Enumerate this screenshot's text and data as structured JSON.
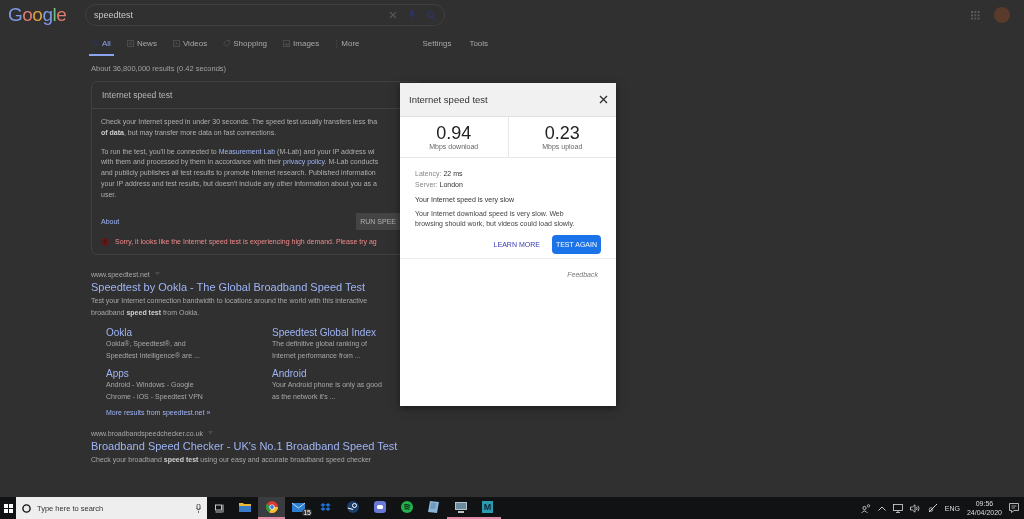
{
  "logo": "Google",
  "search": {
    "value": "speedtest"
  },
  "tabs": [
    {
      "label": "All",
      "kind": "search",
      "selected": true
    },
    {
      "label": "News",
      "kind": "news",
      "selected": false
    },
    {
      "label": "Videos",
      "kind": "play",
      "selected": false
    },
    {
      "label": "Shopping",
      "kind": "tag",
      "selected": false
    },
    {
      "label": "Images",
      "kind": "image",
      "selected": false
    },
    {
      "label": "More",
      "kind": "dots",
      "selected": false
    }
  ],
  "tools": [
    "Settings",
    "Tools"
  ],
  "result_stats": "About 36,800,000 results (0.42 seconds)",
  "speed_card": {
    "title": "Internet speed test",
    "paragraphs": [
      [
        [
          {
            "kind": "text",
            "text": "Check your Internet speed in under 30 seconds. The speed test usually transfers less tha"
          }
        ],
        [
          {
            "kind": "text",
            "text": "**of data**, but may transfer more data on fast connections."
          }
        ]
      ],
      [
        [
          {
            "kind": "text",
            "text": "To run the test, you'll be connected to "
          },
          {
            "kind": "link",
            "text": "Measurement Lab"
          },
          {
            "kind": "text",
            "text": " (M-Lab) and your IP address wi"
          }
        ],
        [
          {
            "kind": "text",
            "text": "with them and processed by them in accordance with their "
          },
          {
            "kind": "link",
            "text": "privacy policy"
          },
          {
            "kind": "text",
            "text": ". M-Lab conducts"
          }
        ],
        [
          {
            "kind": "text",
            "text": "and publicly publishes all test results to promote Internet research. Published information"
          }
        ],
        [
          {
            "kind": "text",
            "text": "your IP address and test results, but doesn't include any other information about you as a"
          }
        ],
        [
          {
            "kind": "text",
            "text": "user."
          }
        ]
      ]
    ],
    "about": "About",
    "run_button": "RUN SPEE",
    "error": "Sorry, it looks like the Internet speed test is experiencing high demand. Please try ag"
  },
  "results": [
    {
      "url": "www.speedtest.net",
      "title": "Speedtest by Ookla - The Global Broadband Speed Test",
      "snippet_lines": [
        "Test your Internet connection bandwidth to locations around the world with this interactive",
        "broadband **speed test** from Ookla."
      ],
      "sitelinks": [
        {
          "title": "Ookla",
          "lines": [
            "Ookla®, Speedtest®, and",
            "Speedtest Intelligence® are ..."
          ]
        },
        {
          "title": "Speedtest Global Index",
          "lines": [
            "The definitive global ranking of",
            "Internet performance from ..."
          ]
        },
        {
          "title": "Apps",
          "lines": [
            "Android - Windows - Google",
            "Chrome - iOS - Speedtest VPN"
          ]
        },
        {
          "title": "Android",
          "lines": [
            "Your Android phone is only as good",
            "as the network it's ..."
          ]
        }
      ],
      "more": "More results from speedtest.net »"
    },
    {
      "url": "www.broadbandspeedchecker.co.uk",
      "title": "Broadband Speed Checker - UK's No.1 Broadband Speed Test",
      "snippet_lines": [
        "Check your broadband **speed test** using our easy and accurate broadband speed checker"
      ]
    }
  ],
  "dialog": {
    "title": "Internet speed test",
    "speeds": [
      {
        "value": "0.94",
        "label": "Mbps download"
      },
      {
        "value": "0.23",
        "label": "Mbps upload"
      }
    ],
    "details": [
      {
        "label": "Latency:",
        "value": "22 ms"
      },
      {
        "label": "Server:",
        "value": "London"
      }
    ],
    "headline": "Your Internet speed is very slow",
    "message_lines": [
      "Your Internet download speed is very slow. Web",
      "browsing should work, but videos could load slowly."
    ],
    "learn_more": "LEARN MORE",
    "test_again": "TEST AGAIN",
    "feedback": "Feedback"
  },
  "taskbar": {
    "search_placeholder": "Type here to search",
    "apps": [
      {
        "kind": "folder",
        "selected": false,
        "running": false
      },
      {
        "kind": "browser",
        "selected": true,
        "running": true
      },
      {
        "kind": "mail",
        "selected": false,
        "running": false,
        "badge": "15"
      },
      {
        "kind": "cloud",
        "selected": false,
        "running": false
      },
      {
        "kind": "steam",
        "selected": false,
        "running": false
      },
      {
        "kind": "chat",
        "selected": false,
        "running": false
      },
      {
        "kind": "music",
        "selected": false,
        "running": false
      },
      {
        "kind": "notes",
        "selected": false,
        "running": false
      },
      {
        "kind": "computer",
        "selected": false,
        "running": true
      },
      {
        "kind": "tile",
        "label": "M",
        "selected": false,
        "running": true
      }
    ],
    "language": "ENG",
    "time": "09:56",
    "date": "24/04/2020"
  }
}
